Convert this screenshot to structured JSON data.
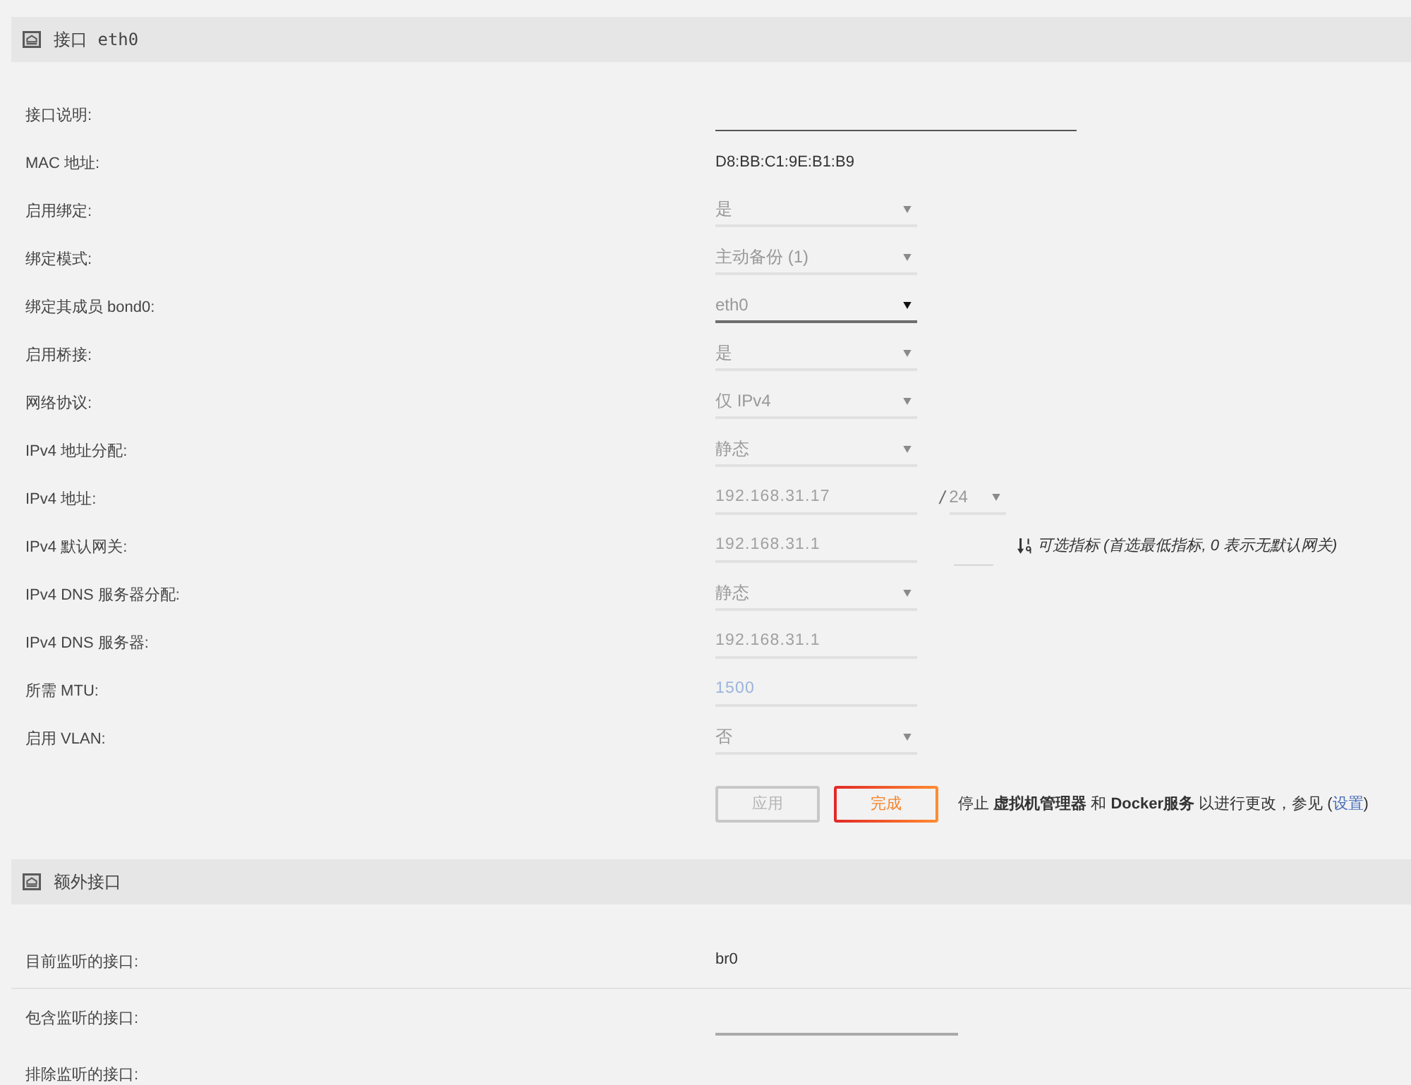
{
  "sections": [
    {
      "title": "接口 eth0",
      "rows": [
        {
          "kind": "wide_input",
          "label": "接口说明:",
          "disabled": false
        },
        {
          "kind": "static",
          "label": "MAC 地址:",
          "value": "D8:BB:C1:9E:B1:B9"
        },
        {
          "kind": "select",
          "label": "启用绑定:",
          "value": "是",
          "disabled": true
        },
        {
          "kind": "select",
          "label": "绑定模式:",
          "value": "主动备份 (1)",
          "disabled": true
        },
        {
          "kind": "select",
          "label": "绑定其成员 bond0:",
          "value": "eth0",
          "disabled": false
        },
        {
          "kind": "select",
          "label": "启用桥接:",
          "value": "是",
          "disabled": true
        },
        {
          "kind": "select",
          "label": "网络协议:",
          "value": "仅 IPv4",
          "disabled": true
        },
        {
          "kind": "select",
          "label": "IPv4 地址分配:",
          "value": "静态",
          "disabled": true
        },
        {
          "kind": "address",
          "label": "IPv4 地址:",
          "value": "192.168.31.17",
          "disabled": true,
          "separator": "/",
          "prefix": {
            "value": "24",
            "disabled": true
          }
        },
        {
          "kind": "gateway",
          "label": "IPv4 默认网关:",
          "value": "192.168.31.1",
          "disabled": true,
          "metric": {
            "disabled": true
          },
          "hint": "可选指标 (首选最低指标, 0 表示无默认网关)"
        },
        {
          "kind": "select",
          "label": "IPv4 DNS 服务器分配:",
          "value": "静态",
          "disabled": true
        },
        {
          "kind": "text_input",
          "label": "IPv4 DNS 服务器:",
          "value": "192.168.31.1",
          "disabled": true
        },
        {
          "kind": "text_input",
          "label": "所需 MTU:",
          "placeholder": "1500",
          "disabled": true
        },
        {
          "kind": "select",
          "label": "启用 VLAN:",
          "value": "否",
          "disabled": true
        }
      ],
      "buttons": [
        {
          "label": "应用",
          "disabled": true
        },
        {
          "label": "完成",
          "disabled": false
        }
      ],
      "notice": {
        "text": "停止 **虚拟机管理器** 和 **Docker服务** 以进行更改，参见 (",
        "link": "设置",
        "text_after": ")"
      }
    },
    {
      "title": "额外接口",
      "rows": [
        {
          "kind": "static",
          "label": "目前监听的接口:",
          "value": "br0",
          "divider": true
        },
        {
          "kind": "list_input",
          "label": "包含监听的接口:"
        },
        {
          "kind": "label_only",
          "label": "排除监听的接口:"
        }
      ]
    }
  ]
}
